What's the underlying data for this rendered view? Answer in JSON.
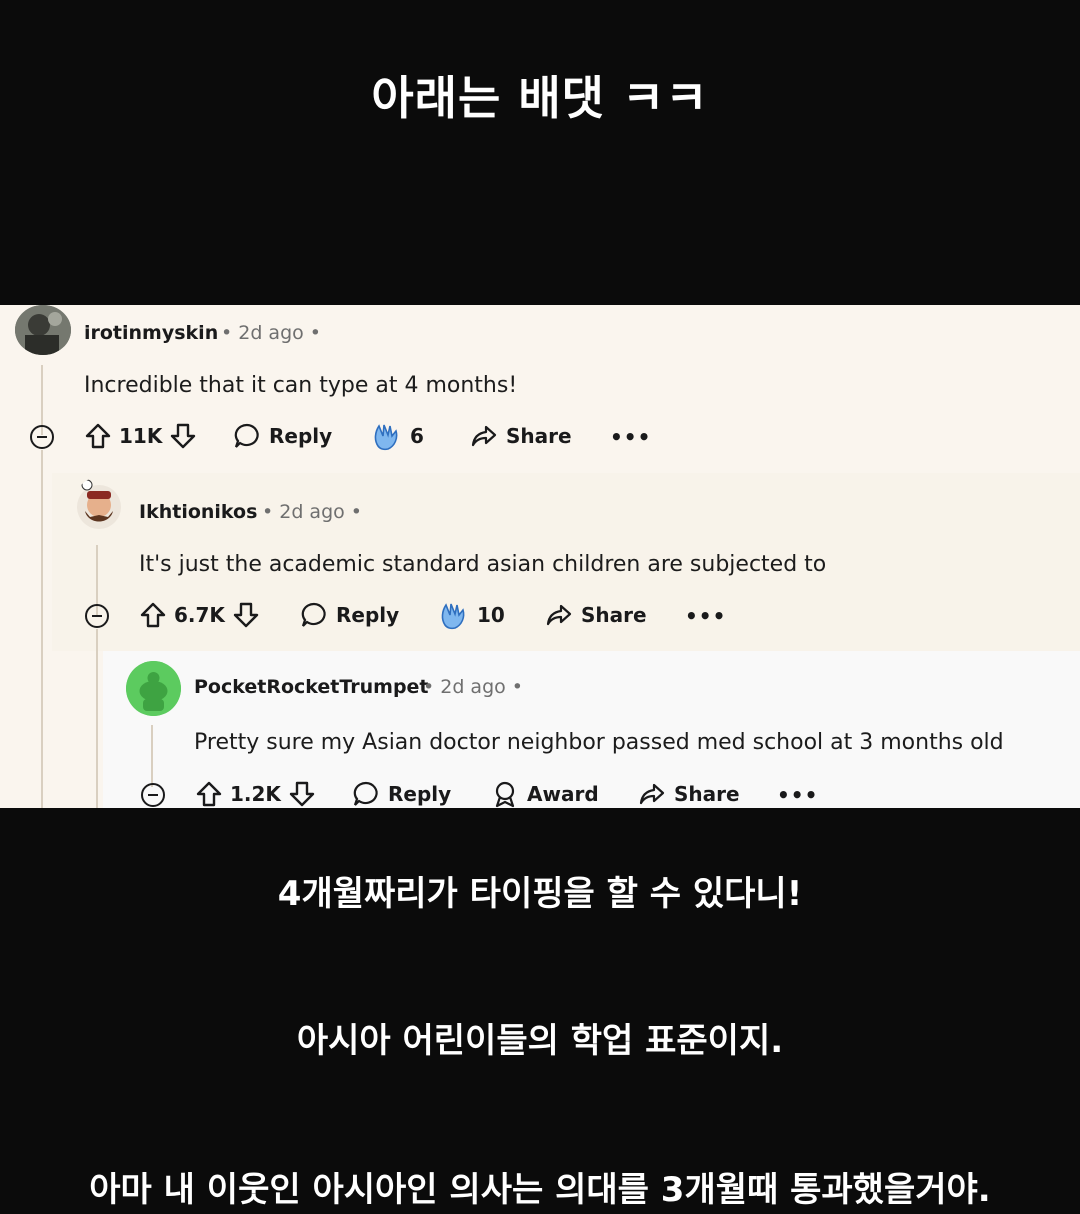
{
  "captions": {
    "title": "아래는 배댓 ㅋㅋ",
    "caption1": "4개월짜리가 타이핑을 할 수 있다니!",
    "caption2": "아시아 어린이들의 학업 표준이지.",
    "caption3": "아마 내 이웃인 아시아인 의사는 의대를 3개월때 통과했을거야."
  },
  "comments": [
    {
      "username": "irotinmyskin",
      "time": "• 2d ago •",
      "text": "Incredible that it can type at 4 months!",
      "upvotes": "11K",
      "reply_label": "Reply",
      "award_count": "6",
      "share_label": "Share",
      "more": "•••"
    },
    {
      "username": "Ikhtionikos",
      "time": "• 2d ago •",
      "text": "It's just the academic standard asian children are subjected to",
      "upvotes": "6.7K",
      "reply_label": "Reply",
      "award_count": "10",
      "share_label": "Share",
      "more": "•••"
    },
    {
      "username": "PocketRocketTrumpet",
      "time": "• 2d ago •",
      "text": "Pretty sure my Asian doctor neighbor passed med school at 3 months old",
      "upvotes": "1.2K",
      "reply_label": "Reply",
      "award_label": "Award",
      "share_label": "Share",
      "more": "•••"
    }
  ],
  "colors": {
    "background": "#0b0b0b",
    "panel": "#faf5ee",
    "award_blue": "#3b8de0",
    "avatar_green": "#5ccb5f"
  },
  "icons": [
    "upvote-icon",
    "downvote-icon",
    "reply-bubble-icon",
    "clapping-hands-icon",
    "share-arrow-icon",
    "award-icon",
    "collapse-icon",
    "more-icon"
  ]
}
